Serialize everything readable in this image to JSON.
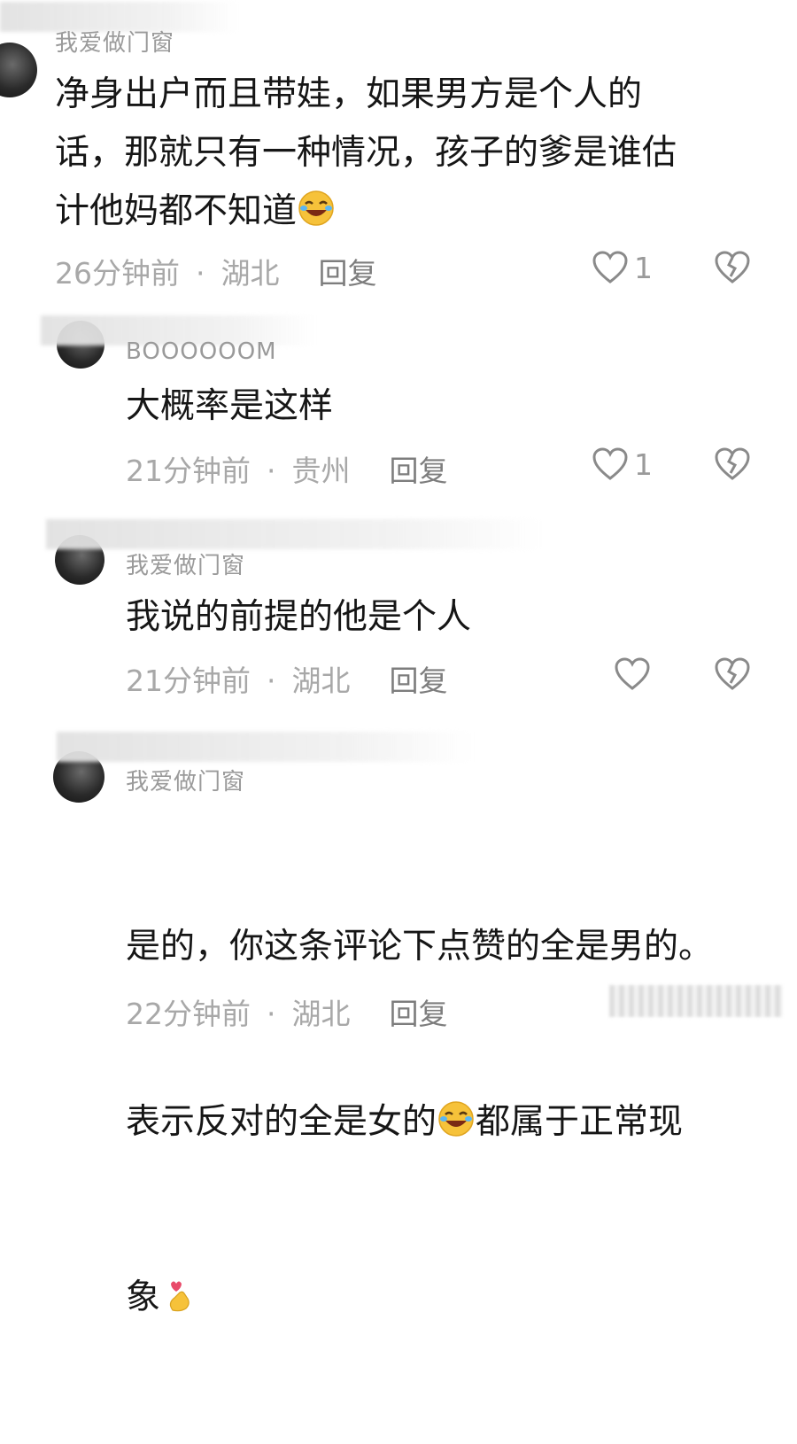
{
  "comments": [
    {
      "name": "我爱做门窗",
      "text": "净身出户而且带娃，如果男方是个人的\n话，那就只有一种情况，孩子的爹是谁估\n计他妈都不知道",
      "time": "26分钟前",
      "sep": "·",
      "location": "湖北",
      "reply": "回复",
      "likes": "1"
    },
    {
      "name": "BOOOOOOM",
      "text": "大概率是这样",
      "time": "21分钟前",
      "sep": "·",
      "location": "贵州",
      "reply": "回复",
      "likes": "1"
    },
    {
      "name": "我爱做门窗",
      "text": "我说的前提的他是个人",
      "time": "21分钟前",
      "sep": "·",
      "location": "湖北",
      "reply": "回复",
      "likes": ""
    },
    {
      "name": "我爱做门窗",
      "text_line1": "是的，你这条评论下点赞的全是男的。",
      "text_line2a": "表示反对的全是女的",
      "text_line2b": "都属于正常现",
      "text_line3": "象",
      "time": "22分钟前",
      "sep": "·",
      "location": "湖北",
      "reply": "回复"
    }
  ],
  "icons": {
    "laugh_emoji": "rolling-on-floor-laughing-emoji",
    "finger_heart_emoji": "finger-heart-emoji",
    "like": "heart-outline-icon",
    "dislike": "broken-heart-icon"
  },
  "colors": {
    "text": "#161616",
    "meta": "#a8a8a8",
    "icon": "#8a8a8a",
    "emoji_yellow": "#f6c23a"
  }
}
